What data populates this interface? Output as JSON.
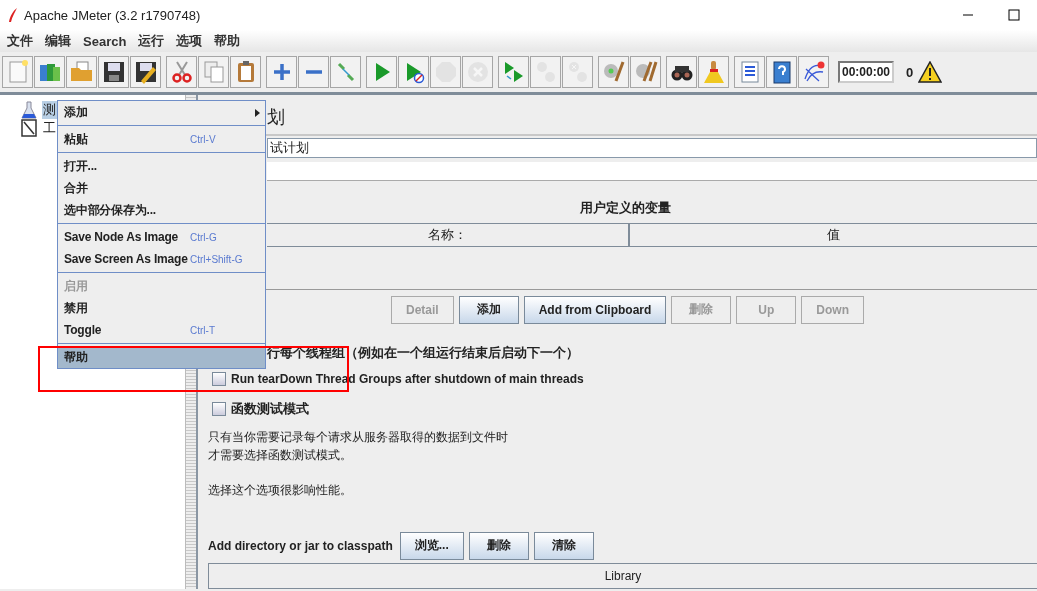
{
  "window": {
    "title": "Apache JMeter (3.2 r1790748)"
  },
  "menu_bar": [
    "文件",
    "编辑",
    "Search",
    "运行",
    "选项",
    "帮助"
  ],
  "toolbar": {
    "groups": [
      [
        {
          "kind": "new",
          "disabled": false
        },
        {
          "kind": "templates",
          "disabled": false
        },
        {
          "kind": "open",
          "disabled": false
        },
        {
          "kind": "save",
          "disabled": false
        },
        {
          "kind": "save_as",
          "disabled": false
        }
      ],
      [
        {
          "kind": "cut",
          "disabled": false
        },
        {
          "kind": "copy",
          "disabled": false
        },
        {
          "kind": "paste",
          "disabled": false
        }
      ],
      [
        {
          "kind": "expand",
          "disabled": false
        },
        {
          "kind": "collapse",
          "disabled": false
        },
        {
          "kind": "toggle",
          "disabled": false
        }
      ],
      [
        {
          "kind": "start",
          "disabled": false
        },
        {
          "kind": "start_no_timers",
          "disabled": false
        },
        {
          "kind": "stop",
          "disabled": true
        },
        {
          "kind": "shutdown",
          "disabled": true
        }
      ],
      [
        {
          "kind": "remote_start",
          "disabled": false
        },
        {
          "kind": "remote_stop",
          "disabled": true
        },
        {
          "kind": "remote_shutdown",
          "disabled": true
        }
      ],
      [
        {
          "kind": "clear",
          "disabled": false
        },
        {
          "kind": "clear_all",
          "disabled": false
        }
      ],
      [
        {
          "kind": "search",
          "disabled": false
        },
        {
          "kind": "reset_search",
          "disabled": false
        }
      ],
      [
        {
          "kind": "function_helper",
          "disabled": false
        },
        {
          "kind": "help",
          "disabled": false
        },
        {
          "kind": "log",
          "disabled": false
        }
      ]
    ],
    "timer": "00:00:00",
    "warning_count": "0"
  },
  "tree": [
    {
      "label": "测",
      "kind": "plan",
      "selected": true
    },
    {
      "label": "工",
      "kind": "workbench",
      "selected": false
    }
  ],
  "context_menu": [
    {
      "kind": "item",
      "label": "添加",
      "submenu": true,
      "disabled": false,
      "selected": false
    },
    {
      "kind": "separator"
    },
    {
      "kind": "item",
      "label": "粘贴",
      "shortcut": "Ctrl-V",
      "disabled": false,
      "selected": false
    },
    {
      "kind": "separator"
    },
    {
      "kind": "item",
      "label": "打开...",
      "disabled": false,
      "selected": false
    },
    {
      "kind": "item",
      "label": "合并",
      "disabled": false,
      "selected": false
    },
    {
      "kind": "item",
      "label": "选中部分保存为...",
      "disabled": false,
      "selected": false
    },
    {
      "kind": "separator"
    },
    {
      "kind": "item",
      "label": "Save Node As Image",
      "shortcut": "Ctrl-G",
      "disabled": false,
      "selected": false
    },
    {
      "kind": "item",
      "label": "Save Screen As Image",
      "shortcut": "Ctrl+Shift-G",
      "disabled": false,
      "selected": false
    },
    {
      "kind": "separator"
    },
    {
      "kind": "item",
      "label": "启用",
      "disabled": true,
      "selected": false
    },
    {
      "kind": "item",
      "label": "禁用",
      "disabled": false,
      "selected": false
    },
    {
      "kind": "item",
      "label": "Toggle",
      "shortcut": "Ctrl-T",
      "disabled": false,
      "selected": false
    },
    {
      "kind": "separator"
    },
    {
      "kind": "item",
      "label": "帮助",
      "disabled": false,
      "selected": true
    }
  ],
  "annotations": [
    {
      "kind": "rectangle"
    }
  ],
  "panel": {
    "title": "划",
    "name_value": "试计划",
    "variables": {
      "title": "用户定义的变量",
      "columns": [
        "名称：",
        "值"
      ]
    },
    "buttons": [
      {
        "label": "Detail",
        "disabled": true
      },
      {
        "label": "添加",
        "disabled": false
      },
      {
        "label": "Add from Clipboard",
        "disabled": false
      },
      {
        "label": "删除",
        "disabled": true
      },
      {
        "label": "Up",
        "disabled": true
      },
      {
        "label": "Down",
        "disabled": true
      }
    ],
    "serial_option_label": "行每个线程组（例如在一个组运行结束后启动下一个）",
    "options": [
      {
        "label": "Run tearDown Thread Groups after shutdown of main threads",
        "checked": false
      },
      {
        "label": "函数测试模式",
        "checked": false
      }
    ],
    "paragraphs": [
      [
        "只有当你需要记录每个请求从服务器取得的数据到文件时",
        "才需要选择函数测试模式。"
      ],
      [
        "选择这个选项很影响性能。"
      ]
    ],
    "classpath": {
      "label": "Add directory or jar to classpath",
      "buttons": [
        "浏览...",
        "删除",
        "清除"
      ],
      "columns": [
        "Library"
      ]
    }
  }
}
